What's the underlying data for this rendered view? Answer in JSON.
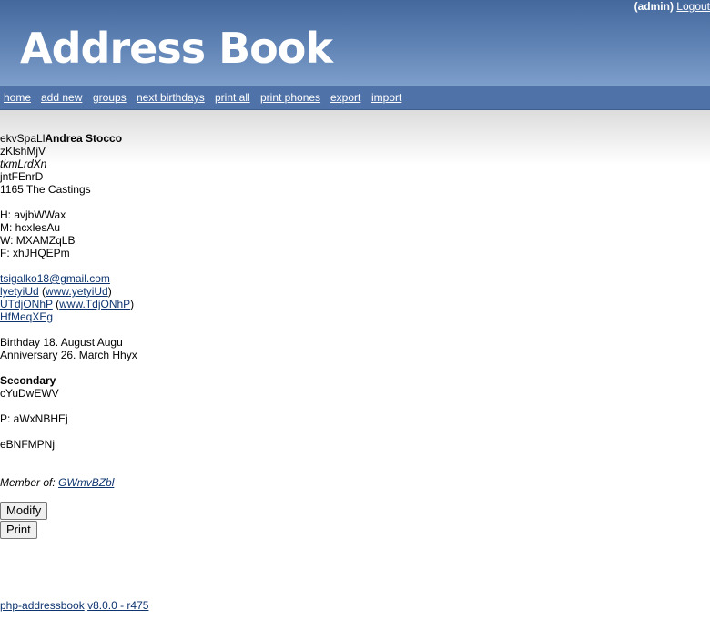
{
  "header": {
    "user": "(admin)",
    "logout": "Logout",
    "logo": "Address Book"
  },
  "nav": [
    {
      "label": "home"
    },
    {
      "label": "add new"
    },
    {
      "label": "groups"
    },
    {
      "label": "next birthdays"
    },
    {
      "label": "print all"
    },
    {
      "label": "print phones"
    },
    {
      "label": "export"
    },
    {
      "label": "import"
    }
  ],
  "contact": {
    "name_prefix": "ekvSpaLl",
    "name": "Andrea Stocco",
    "nickname": "zKlshMjV",
    "title": "tkmLrdXn",
    "company": "jntFEnrD",
    "address": "1165 The Castings",
    "phone_home": "H: avjbWWax",
    "phone_mobile": "M: hcxIesAu",
    "phone_work": "W: MXAMZqLB",
    "fax": "F: xhJHQEPm",
    "email": "tsigalko18@gmail.com",
    "web1_name": "lyetyiUd",
    "web1_url": "www.yetyiUd",
    "web2_name": "UTdjONhP",
    "web2_url": "www.TdjONhP",
    "web3_name": "HfMeqXEg",
    "birthday": "Birthday 18. August Augu",
    "anniversary": "Anniversary 26. March Hhyx",
    "secondary_heading": "Secondary",
    "secondary_address": "cYuDwEWV",
    "secondary_phone": "P: aWxNBHEj",
    "notes": "eBNFMPNj",
    "member_of_label": "Member of:",
    "group": "GWmvBZbl"
  },
  "buttons": {
    "modify": "Modify",
    "print": "Print"
  },
  "footer": {
    "app": "php-addressbook",
    "version": "v8.0.0 - r475"
  }
}
